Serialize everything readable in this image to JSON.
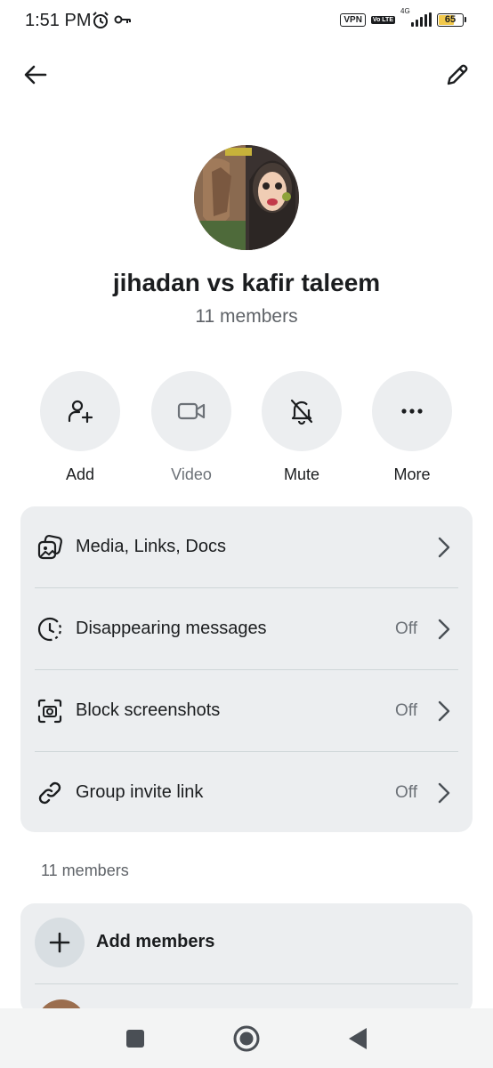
{
  "status_bar": {
    "time": "1:51 PM",
    "vpn": "VPN",
    "volte": "Vo LTE",
    "network": "4G",
    "battery": "65",
    "icons": [
      "alarm-icon",
      "key-icon",
      "signal-icon",
      "battery-icon"
    ]
  },
  "top_bar": {
    "back_icon": "arrow-left-icon",
    "edit_icon": "pencil-icon"
  },
  "group": {
    "name": "jihadan vs kafir taleem",
    "members_count": "11 members"
  },
  "actions": [
    {
      "label": "Add",
      "icon": "add-person-icon"
    },
    {
      "label": "Video",
      "icon": "video-camera-icon"
    },
    {
      "label": "Mute",
      "icon": "bell-off-icon"
    },
    {
      "label": "More",
      "icon": "more-dots-icon"
    }
  ],
  "settings": [
    {
      "label": "Media, Links, Docs",
      "value": "",
      "icon": "media-icon"
    },
    {
      "label": "Disappearing messages",
      "value": "Off",
      "icon": "timer-icon"
    },
    {
      "label": "Block screenshots",
      "value": "Off",
      "icon": "screenshot-camera-icon"
    },
    {
      "label": "Group invite link",
      "value": "Off",
      "icon": "link-icon"
    }
  ],
  "members_section": {
    "title": "11 members",
    "add_label": "Add members"
  },
  "colors": {
    "card_bg": "#eceef0",
    "text": "#1b1d1f",
    "muted": "#6c7177",
    "battery_fill": "#f2c94c"
  }
}
